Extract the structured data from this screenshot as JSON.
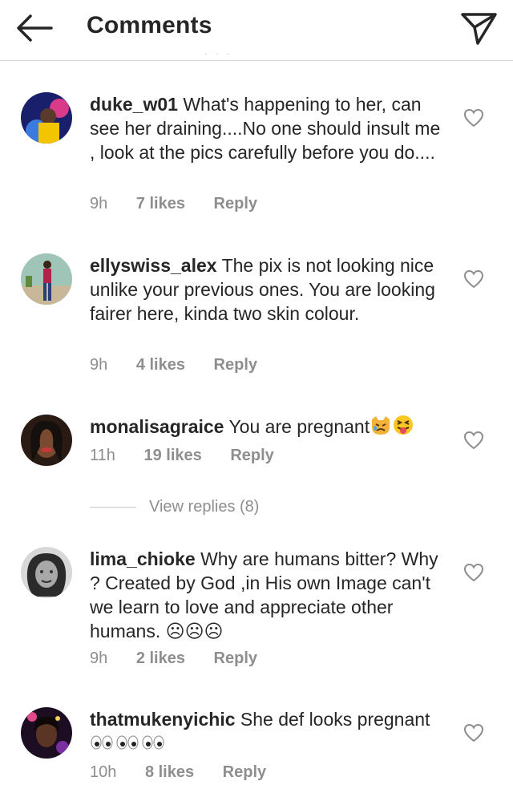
{
  "header": {
    "title": "Comments",
    "scroll_hint": "· · ·"
  },
  "comments": [
    {
      "username": "duke_w01",
      "text": "What's happening to her, can see her draining....No one should insult me , look at the pics carefully before you do....",
      "time": "9h",
      "likes": "7 likes",
      "reply": "Reply"
    },
    {
      "username": "ellyswiss_alex",
      "text": "The pix is not looking nice unlike your previous ones. You are looking fairer here, kinda two skin colour.",
      "time": "9h",
      "likes": "4 likes",
      "reply": "Reply"
    },
    {
      "username": "monalisagraice",
      "text": "You are pregnant",
      "emoji": [
        "crying-cat-emoji",
        "squinting-tongue-emoji"
      ],
      "time": "11h",
      "likes": "19 likes",
      "reply": "Reply"
    },
    {
      "username": "lima_chioke",
      "text": "Why are humans  bitter? Why ? Created  by God ,in His own Image can't we learn to love and appreciate other humans. ☹☹☹",
      "time": "9h",
      "likes": "2 likes",
      "reply": "Reply"
    },
    {
      "username": "thatmukenyichic",
      "text": "She def looks pregnant",
      "emoji": [
        "eyes-emoji",
        "eyes-emoji",
        "eyes-emoji"
      ],
      "time": "10h",
      "likes": "8 likes",
      "reply": "Reply"
    }
  ],
  "view_replies": "View replies (8)",
  "colors": {
    "text": "#262626",
    "secondary": "#8e8e8e",
    "divider": "#dbdbdb"
  }
}
